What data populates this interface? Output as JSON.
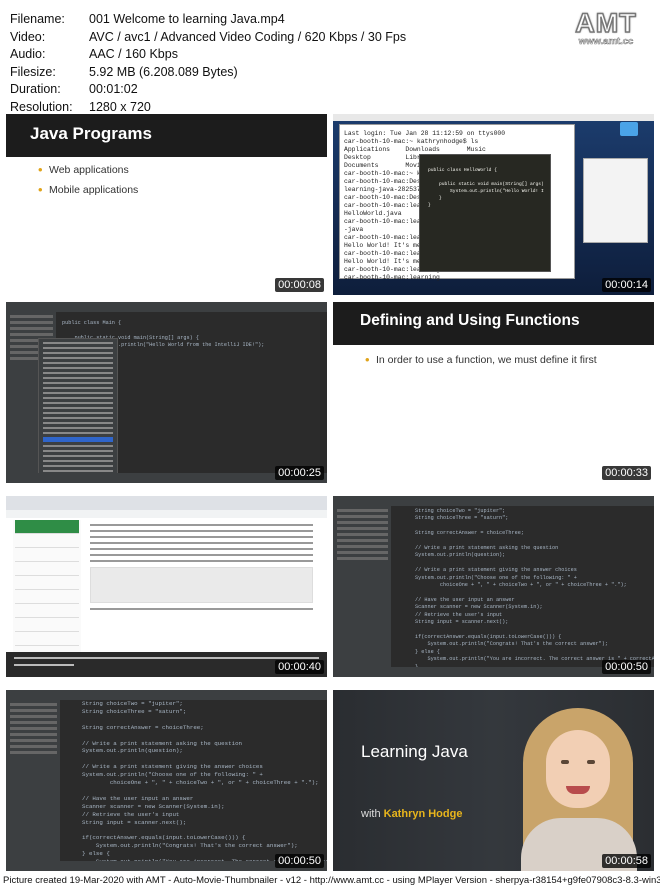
{
  "meta": [
    {
      "key": "Filename:",
      "value": "001 Welcome to learning Java.mp4"
    },
    {
      "key": "Video:",
      "value": "AVC / avc1 / Advanced Video Coding / 620 Kbps / 30 Fps"
    },
    {
      "key": "Audio:",
      "value": "AAC / 160 Kbps"
    },
    {
      "key": "Filesize:",
      "value": "5.92 MB (6.208.089 Bytes)"
    },
    {
      "key": "Duration:",
      "value": "00:01:02"
    },
    {
      "key": "Resolution:",
      "value": "1280 x 720"
    }
  ],
  "logo": {
    "big": "AMT",
    "url": "www.amt.cc"
  },
  "thumbs": {
    "t1": {
      "time": "00:00:08",
      "title": "Java Programs",
      "bullets": [
        "Web applications",
        "Mobile applications"
      ]
    },
    "t2": {
      "time": "00:00:14",
      "terminal": "Last login: Tue Jan 28 11:12:59 on ttys000\ncar-booth-10-mac:~ kathrynhodge$ ls\nApplications    Downloads       Music\nDesktop         Library\nDocuments       Movies\ncar-booth-10-mac:~ kath\ncar-booth-10-mac:Desktop\nlearning-java-2825378\ncar-booth-10-mac:Desktop\ncar-booth-10-mac:learning\nHelloWorld.java\ncar-booth-10-mac:learning\n-java\ncar-booth-10-mac:learning\nHello World! It's me Kat\ncar-booth-10-mac:learning\nHello World! It's me Kat\ncar-booth-10-mac:learning\ncar-booth-10-mac:learning",
      "sublime": "public class HelloWorld {\n\n    public static void main(String[] args)\n        System.out.println(\"Hello World! I\n    }\n}"
    },
    "t3": {
      "time": "00:00:25",
      "code": "public class Main {\n\n    public static void main(String[] args) {\n        System.out.println(\"Hello World from the IntelliJ IDE!\");\n    }\n}"
    },
    "t4": {
      "time": "00:00:33",
      "title": "Defining and Using Functions",
      "bullets": [
        "In order to use a function, we must define it first"
      ]
    },
    "t5": {
      "time": "00:00:40"
    },
    "t6": {
      "time": "00:00:50",
      "code": "String choiceTwo = \"jupiter\";\nString choiceThree = \"saturn\";\n\nString correctAnswer = choiceThree;\n\n// Write a print statement asking the question\nSystem.out.println(question);\n\n// Write a print statement giving the answer choices\nSystem.out.println(\"Choose one of the following: \" +\n        choiceOne + \", \" + choiceTwo + \", or \" + choiceThree + \".\");\n\n// Have the user input an answer\nScanner scanner = new Scanner(System.in);\n// Retrieve the user's input\nString input = scanner.next();\n\nif(correctAnswer.equals(input.toLowerCase())) {\n    System.out.println(\"Congrats! That's the correct answer\");\n} else {\n    System.out.println(\"You are incorrect. The correct answer is \" + correctAnswer);\n}"
    },
    "t7": {
      "time": "00:00:50",
      "code": "String choiceTwo = \"jupiter\";\nString choiceThree = \"saturn\";\n\nString correctAnswer = choiceThree;\n\n// Write a print statement asking the question\nSystem.out.println(question);\n\n// Write a print statement giving the answer choices\nSystem.out.println(\"Choose one of the following: \" +\n        choiceOne + \", \" + choiceTwo + \", or \" + choiceThree + \".\");\n\n// Have the user input an answer\nScanner scanner = new Scanner(System.in);\n// Retrieve the user's input\nString input = scanner.next();\n\nif(correctAnswer.equals(input.toLowerCase())) {\n    System.out.println(\"Congrats! That's the correct answer\");\n} else {\n    System.out.println(\"You are incorrect. The correct answer is \" + correctAnswer);\n}"
    },
    "t8": {
      "time": "00:00:58",
      "title": "Learning Java",
      "with": "with",
      "author": "Kathryn Hodge"
    }
  },
  "footer": "Picture created 19-Mar-2020 with AMT - Auto-Movie-Thumbnailer - v12 - http://www.amt.cc - using MPlayer Version - sherpya-r38154+g9fe07908c3-8.3-win32"
}
